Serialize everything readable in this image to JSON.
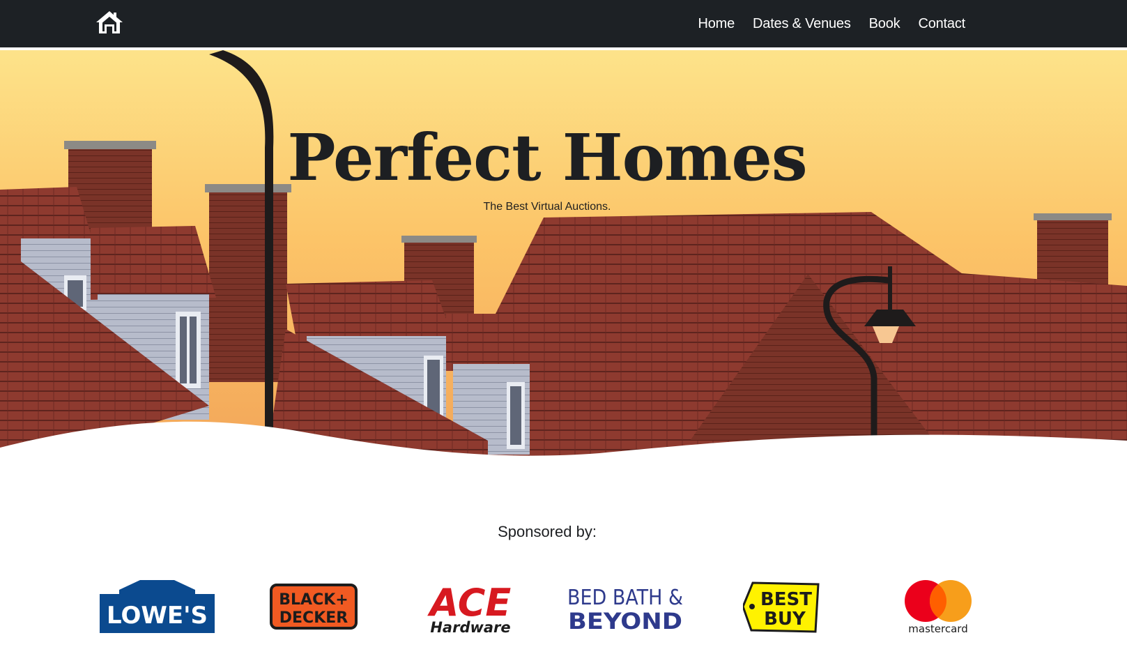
{
  "nav": {
    "brand_icon": "home-icon",
    "links": [
      "Home",
      "Dates & Venues",
      "Book",
      "Contact"
    ]
  },
  "hero": {
    "title": "Perfect Homes",
    "subtitle": "The Best Virtual Auctions."
  },
  "sponsors": {
    "heading": "Sponsored by:",
    "logos": [
      {
        "name": "Lowe's",
        "text": "LOWE'S"
      },
      {
        "name": "Black+Decker",
        "line1": "BLACK+",
        "line2": "DECKER"
      },
      {
        "name": "Ace Hardware",
        "line1": "ACE",
        "line2": "Hardware"
      },
      {
        "name": "Bed Bath & Beyond",
        "line1": "BED BATH &",
        "line2": "BEYOND"
      },
      {
        "name": "Best Buy",
        "line1": "BEST",
        "line2": "BUY"
      },
      {
        "name": "Mastercard",
        "text": "mastercard"
      }
    ]
  },
  "colors": {
    "navbar": "#1d2125",
    "lowes_blue": "#0b4a8f",
    "blackdecker_orange": "#f15a22",
    "ace_red": "#d71920",
    "bbb_blue": "#2e3a8c",
    "bestbuy_yellow": "#fff200",
    "mc_red": "#eb001b",
    "mc_orange": "#f79e1b"
  }
}
